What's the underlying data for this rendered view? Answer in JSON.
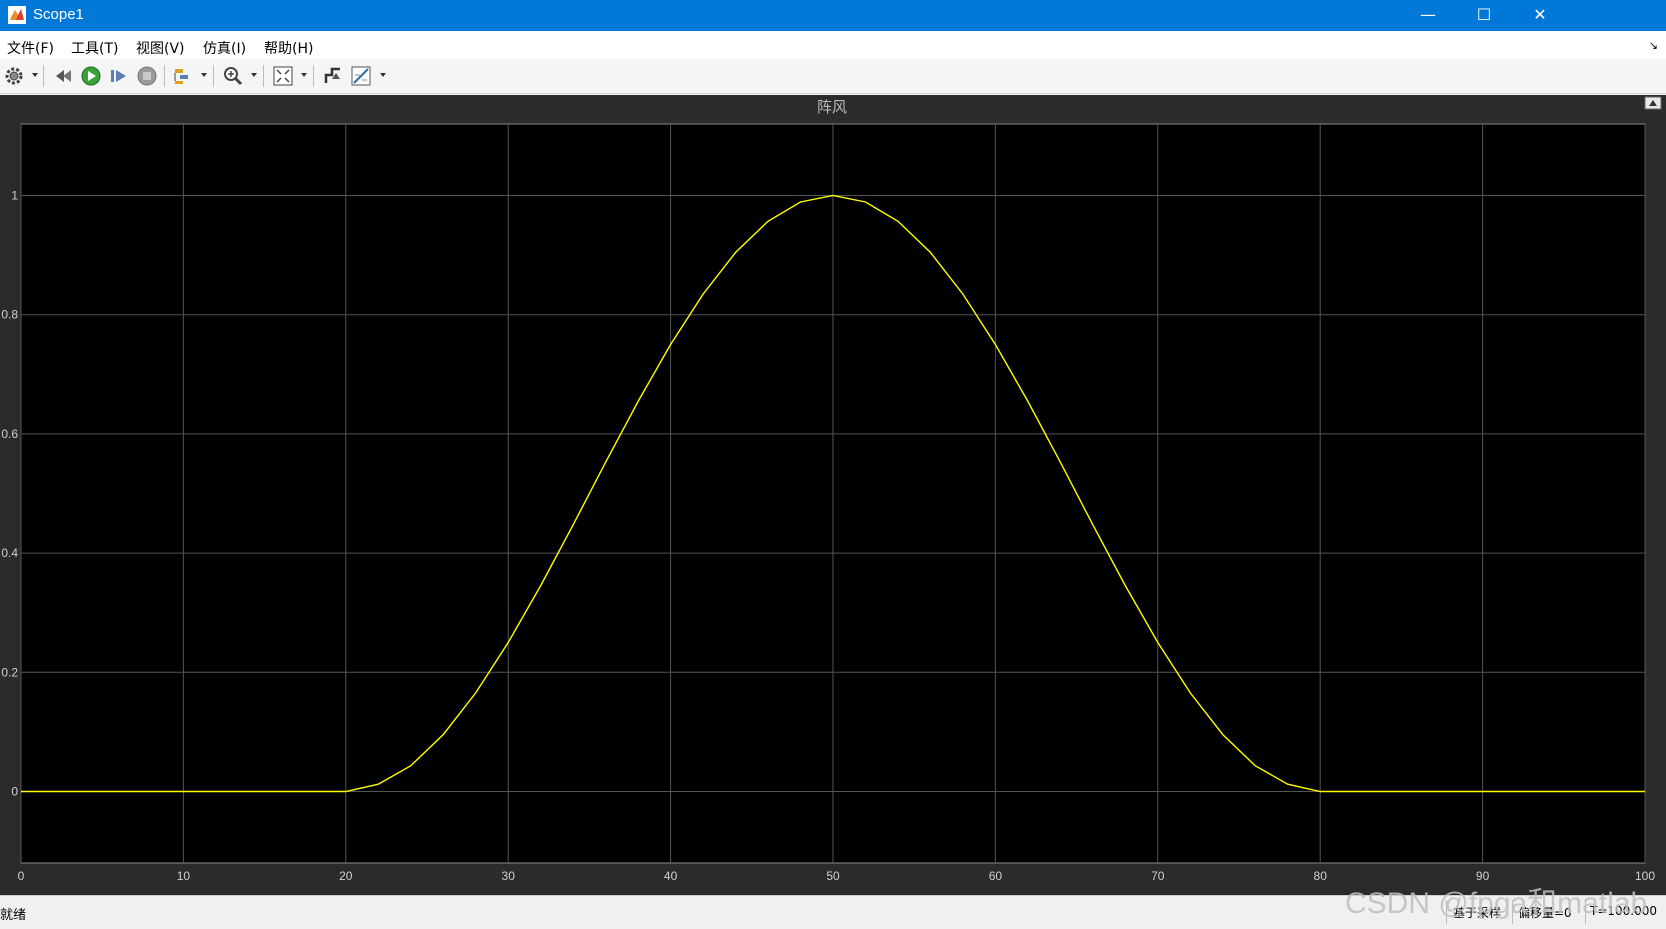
{
  "window": {
    "title": "Scope1",
    "minimize_glyph": "—",
    "maximize_glyph": "☐",
    "close_glyph": "✕"
  },
  "menu": [
    "文件(F)",
    "工具(T)",
    "视图(V)",
    "仿真(I)",
    "帮助(H)"
  ],
  "toolbar": {
    "icons": [
      "gear-icon",
      "step-back-icon",
      "run-icon",
      "step-forward-icon",
      "stop-icon",
      "signal-select-icon",
      "zoom-in-icon",
      "fit-to-view-icon",
      "triggers-icon",
      "measurement-icon"
    ]
  },
  "chart_data": {
    "type": "line",
    "title": "阵风",
    "xlabel": "",
    "ylabel": "",
    "xlim": [
      0,
      100
    ],
    "ylim": [
      -0.12,
      1.12
    ],
    "xticks": [
      0,
      10,
      20,
      30,
      40,
      50,
      60,
      70,
      80,
      90,
      100
    ],
    "yticks": [
      0,
      0.2,
      0.4,
      0.6,
      0.8,
      1
    ],
    "grid": true,
    "background": "#000000",
    "line_color": "#ffff00",
    "series": [
      {
        "x": [
          0,
          20,
          22,
          24,
          26,
          28,
          30,
          32,
          34,
          36,
          38,
          40,
          42,
          44,
          46,
          48,
          50,
          52,
          54,
          56,
          58,
          60,
          62,
          64,
          66,
          68,
          70,
          72,
          74,
          76,
          78,
          80,
          100
        ],
        "values": [
          0,
          0,
          0.0123,
          0.0432,
          0.0955,
          0.1654,
          0.25,
          0.3455,
          0.4477,
          0.5523,
          0.6545,
          0.75,
          0.8346,
          0.9045,
          0.9568,
          0.9891,
          1,
          0.9891,
          0.9568,
          0.9045,
          0.8346,
          0.75,
          0.6545,
          0.5523,
          0.4477,
          0.3455,
          0.25,
          0.1654,
          0.0955,
          0.0432,
          0.0123,
          0,
          0
        ]
      }
    ]
  },
  "status": {
    "ready": "就绪",
    "sampling": "基于采样",
    "offset": "偏移量=0",
    "time": "T=100.000"
  },
  "watermark": "CSDN @fpga和matlab"
}
